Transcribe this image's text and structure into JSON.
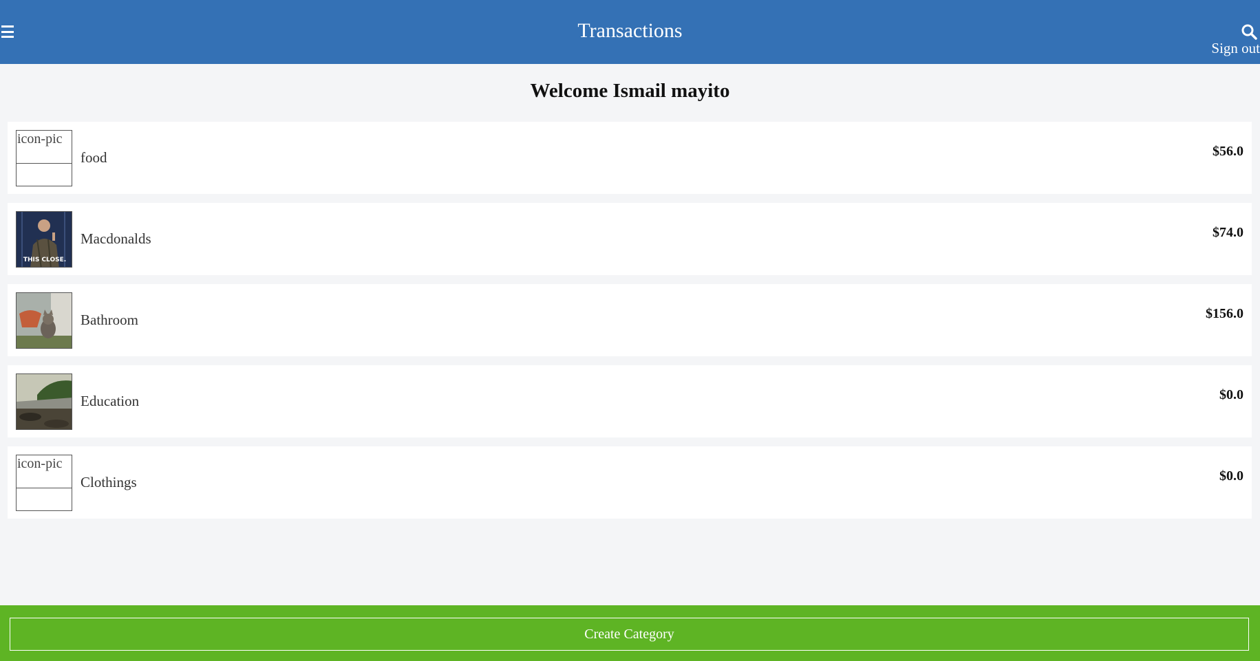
{
  "header": {
    "title": "Transactions",
    "sign_out_label": "Sign out",
    "color": "#3471b5"
  },
  "welcome": "Welcome Ismail mayito",
  "categories": [
    {
      "label": "food",
      "amount": "$56.0",
      "icon_alt": "icon-pic",
      "icon": "broken-image"
    },
    {
      "label": "Macdonalds",
      "amount": "$74.0",
      "icon": "photo-man-this-close"
    },
    {
      "label": "Bathroom",
      "amount": "$156.0",
      "icon": "photo-kitten"
    },
    {
      "label": "Education",
      "amount": "$0.0",
      "icon": "photo-landscape"
    },
    {
      "label": "Clothings",
      "amount": "$0.0",
      "icon_alt": "icon-pic",
      "icon": "broken-image"
    }
  ],
  "thumb_overlay_text": "THIS CLOSE.",
  "footer": {
    "create_label": "Create Category",
    "color": "#5eb424"
  }
}
